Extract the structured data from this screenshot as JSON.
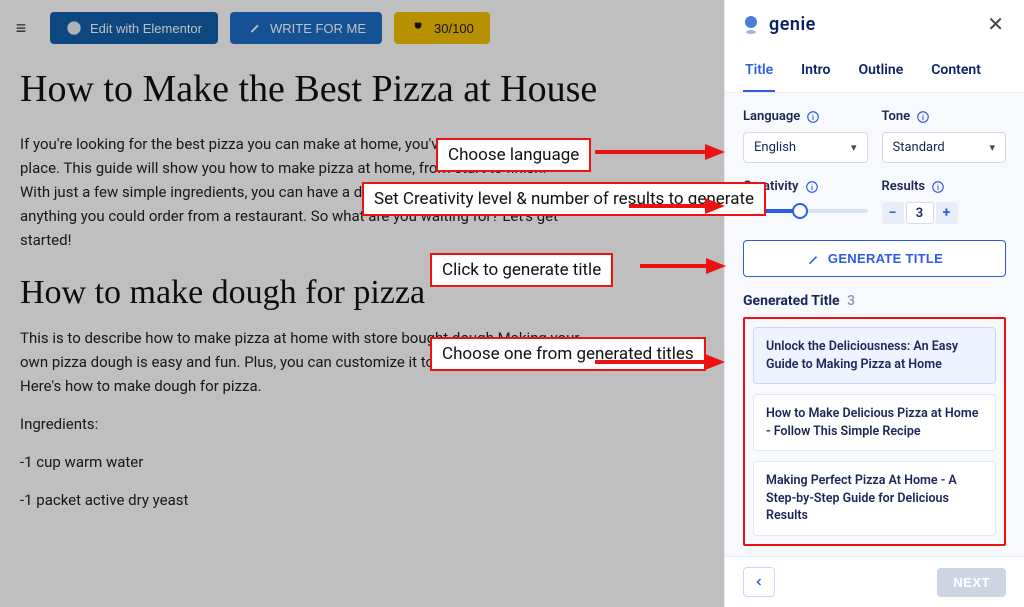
{
  "toolbar": {
    "edit_label": "Edit with Elementor",
    "write_label": "WRITE FOR ME",
    "score_label": "30/100"
  },
  "content": {
    "title": "How to Make the Best Pizza at House",
    "intro": "If you're looking for the best pizza you can make at home, you've come to the right place. This guide will show you how to make pizza at home, from start to finish. With just a few simple ingredients, you can have a delicious pizza that's better than anything you could order from a restaurant. So what are you waiting for? Let's get started!",
    "heading2": "How to make dough for pizza",
    "para2": "This is to describe how to make pizza at home with store bought dough Making your own pizza dough is easy and fun. Plus, you can customize it to your own taste. Here's how to make dough for pizza.",
    "ingredients_label": "Ingredients:",
    "ing1": "-1 cup warm water",
    "ing2": "-1 packet active dry yeast"
  },
  "sidebar": {
    "brand": "genie",
    "tabs": [
      "Title",
      "Intro",
      "Outline",
      "Content"
    ],
    "language_label": "Language",
    "language_value": "English",
    "tone_label": "Tone",
    "tone_value": "Standard",
    "creativity_label": "Creativity",
    "results_label": "Results",
    "results_value": "3",
    "generate_label": "GENERATE TITLE",
    "generated_label": "Generated Title",
    "generated_count": "3",
    "results": [
      "Unlock the Deliciousness: An Easy Guide to Making Pizza at Home",
      "How to Make Delicious Pizza at Home - Follow This Simple Recipe",
      "Making Perfect Pizza At Home - A Step-by-Step Guide for Delicious Results"
    ],
    "next_label": "NEXT"
  },
  "callouts": {
    "c1": "Choose language",
    "c2": "Set Creativity level & number of results to generate",
    "c3": "Click to generate title",
    "c4": "Choose one from generated titles"
  }
}
